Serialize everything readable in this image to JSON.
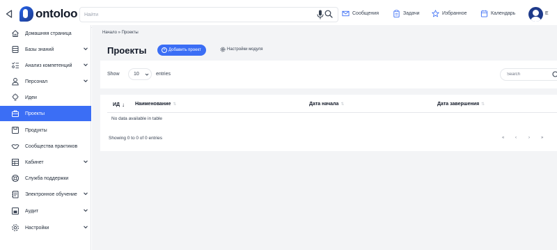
{
  "topbar": {
    "logo_text": "ontoloo",
    "search_placeholder": "Найти",
    "nav": [
      {
        "label": "Сообщения",
        "icon": "mail-icon"
      },
      {
        "label": "Задачи",
        "icon": "clipboard-icon"
      },
      {
        "label": "Избранное",
        "icon": "star-icon"
      },
      {
        "label": "Календарь",
        "icon": "calendar-icon"
      }
    ],
    "avatar_tail": "Е"
  },
  "sidebar": {
    "items": [
      {
        "label": "Домашняя страница",
        "icon": "home-icon",
        "expandable": false
      },
      {
        "label": "Базы знаний",
        "icon": "database-icon",
        "expandable": true
      },
      {
        "label": "Анализ компетенций",
        "icon": "analysis-icon",
        "expandable": true
      },
      {
        "label": "Персонал",
        "icon": "person-icon",
        "expandable": true
      },
      {
        "label": "Идеи",
        "icon": "lightbulb-icon",
        "expandable": false
      },
      {
        "label": "Проекты",
        "icon": "briefcase-icon",
        "expandable": false,
        "active": true
      },
      {
        "label": "Продукты",
        "icon": "product-icon",
        "expandable": false
      },
      {
        "label": "Сообщества практиков",
        "icon": "community-icon",
        "expandable": false
      },
      {
        "label": "Кабинет",
        "icon": "cabinet-icon",
        "expandable": true
      },
      {
        "label": "Служба поддержки",
        "icon": "support-icon",
        "expandable": false
      },
      {
        "label": "Электронное обучение",
        "icon": "elearning-icon",
        "expandable": true
      },
      {
        "label": "Аудит",
        "icon": "audit-icon",
        "expandable": true
      },
      {
        "label": "Настройки",
        "icon": "gear-icon",
        "expandable": true
      }
    ]
  },
  "main": {
    "breadcrumb": "Начало » Проекты",
    "title": "Проекты",
    "add_button": "Добавить проект",
    "settings_link": "Настройки модуля",
    "show_label": "Show",
    "page_size": "10",
    "entries_label": "entries",
    "search_placeholder": "Search",
    "columns": [
      "ИД",
      "Наименование",
      "Дата начала",
      "Дата завершения"
    ],
    "empty_text": "No data available in table",
    "info_text": "Showing 0 to 0 of 0 entries",
    "pager": [
      "«",
      "‹",
      "›",
      "»"
    ]
  },
  "colors": {
    "accent": "#3b6ef5",
    "logo_blue": "#1e3a8a",
    "page_bg": "#f3f4f6"
  }
}
